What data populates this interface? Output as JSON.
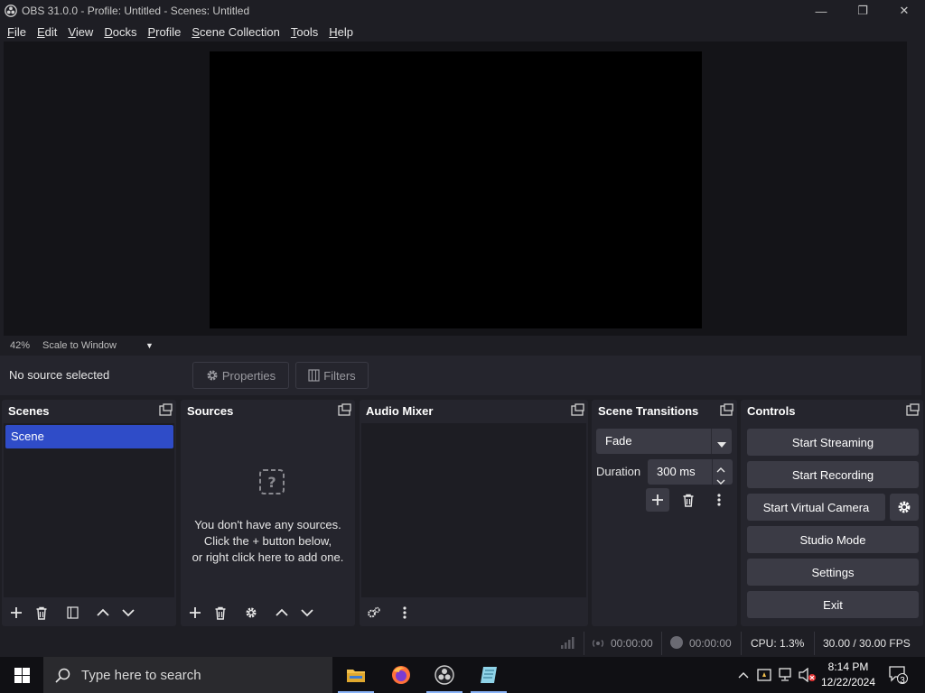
{
  "window": {
    "title": "OBS 31.0.0 - Profile: Untitled - Scenes: Untitled",
    "minimize": "—",
    "maximize": "❐",
    "close": "✕"
  },
  "menu": [
    {
      "label": "File",
      "accel": "F",
      "rest": "ile"
    },
    {
      "label": "Edit",
      "accel": "E",
      "rest": "dit"
    },
    {
      "label": "View",
      "accel": "V",
      "rest": "iew"
    },
    {
      "label": "Docks",
      "accel": "D",
      "rest": "ocks"
    },
    {
      "label": "Profile",
      "accel": "P",
      "rest": "rofile"
    },
    {
      "label": "Scene Collection",
      "accel": "S",
      "rest": "cene Collection"
    },
    {
      "label": "Tools",
      "accel": "T",
      "rest": "ools"
    },
    {
      "label": "Help",
      "accel": "H",
      "rest": "elp"
    }
  ],
  "zoom": {
    "percent": "42%",
    "mode": "Scale to Window"
  },
  "source_toolbar": {
    "no_source": "No source selected",
    "properties": "Properties",
    "filters": "Filters"
  },
  "scenes": {
    "title": "Scenes",
    "items": [
      "Scene"
    ]
  },
  "sources": {
    "title": "Sources",
    "empty_line1": "You don't have any sources.",
    "empty_line2": "Click the + button below,",
    "empty_line3": "or right click here to add one."
  },
  "audio_mixer": {
    "title": "Audio Mixer"
  },
  "transitions": {
    "title": "Scene Transitions",
    "selected": "Fade",
    "duration_label": "Duration",
    "duration_value": "300 ms"
  },
  "controls": {
    "title": "Controls",
    "start_streaming": "Start Streaming",
    "start_recording": "Start Recording",
    "start_virtual_camera": "Start Virtual Camera",
    "studio_mode": "Studio Mode",
    "settings": "Settings",
    "exit": "Exit"
  },
  "status": {
    "stream_time": "00:00:00",
    "record_time": "00:00:00",
    "cpu": "CPU: 1.3%",
    "fps": "30.00 / 30.00 FPS"
  },
  "taskbar": {
    "search_placeholder": "Type here to search",
    "time": "8:14 PM",
    "date": "12/22/2024",
    "notifications": "3"
  },
  "colors": {
    "accent": "#2f4cc8",
    "background": "#1e1e24",
    "dock": "#25252d",
    "button": "#3b3b45"
  }
}
